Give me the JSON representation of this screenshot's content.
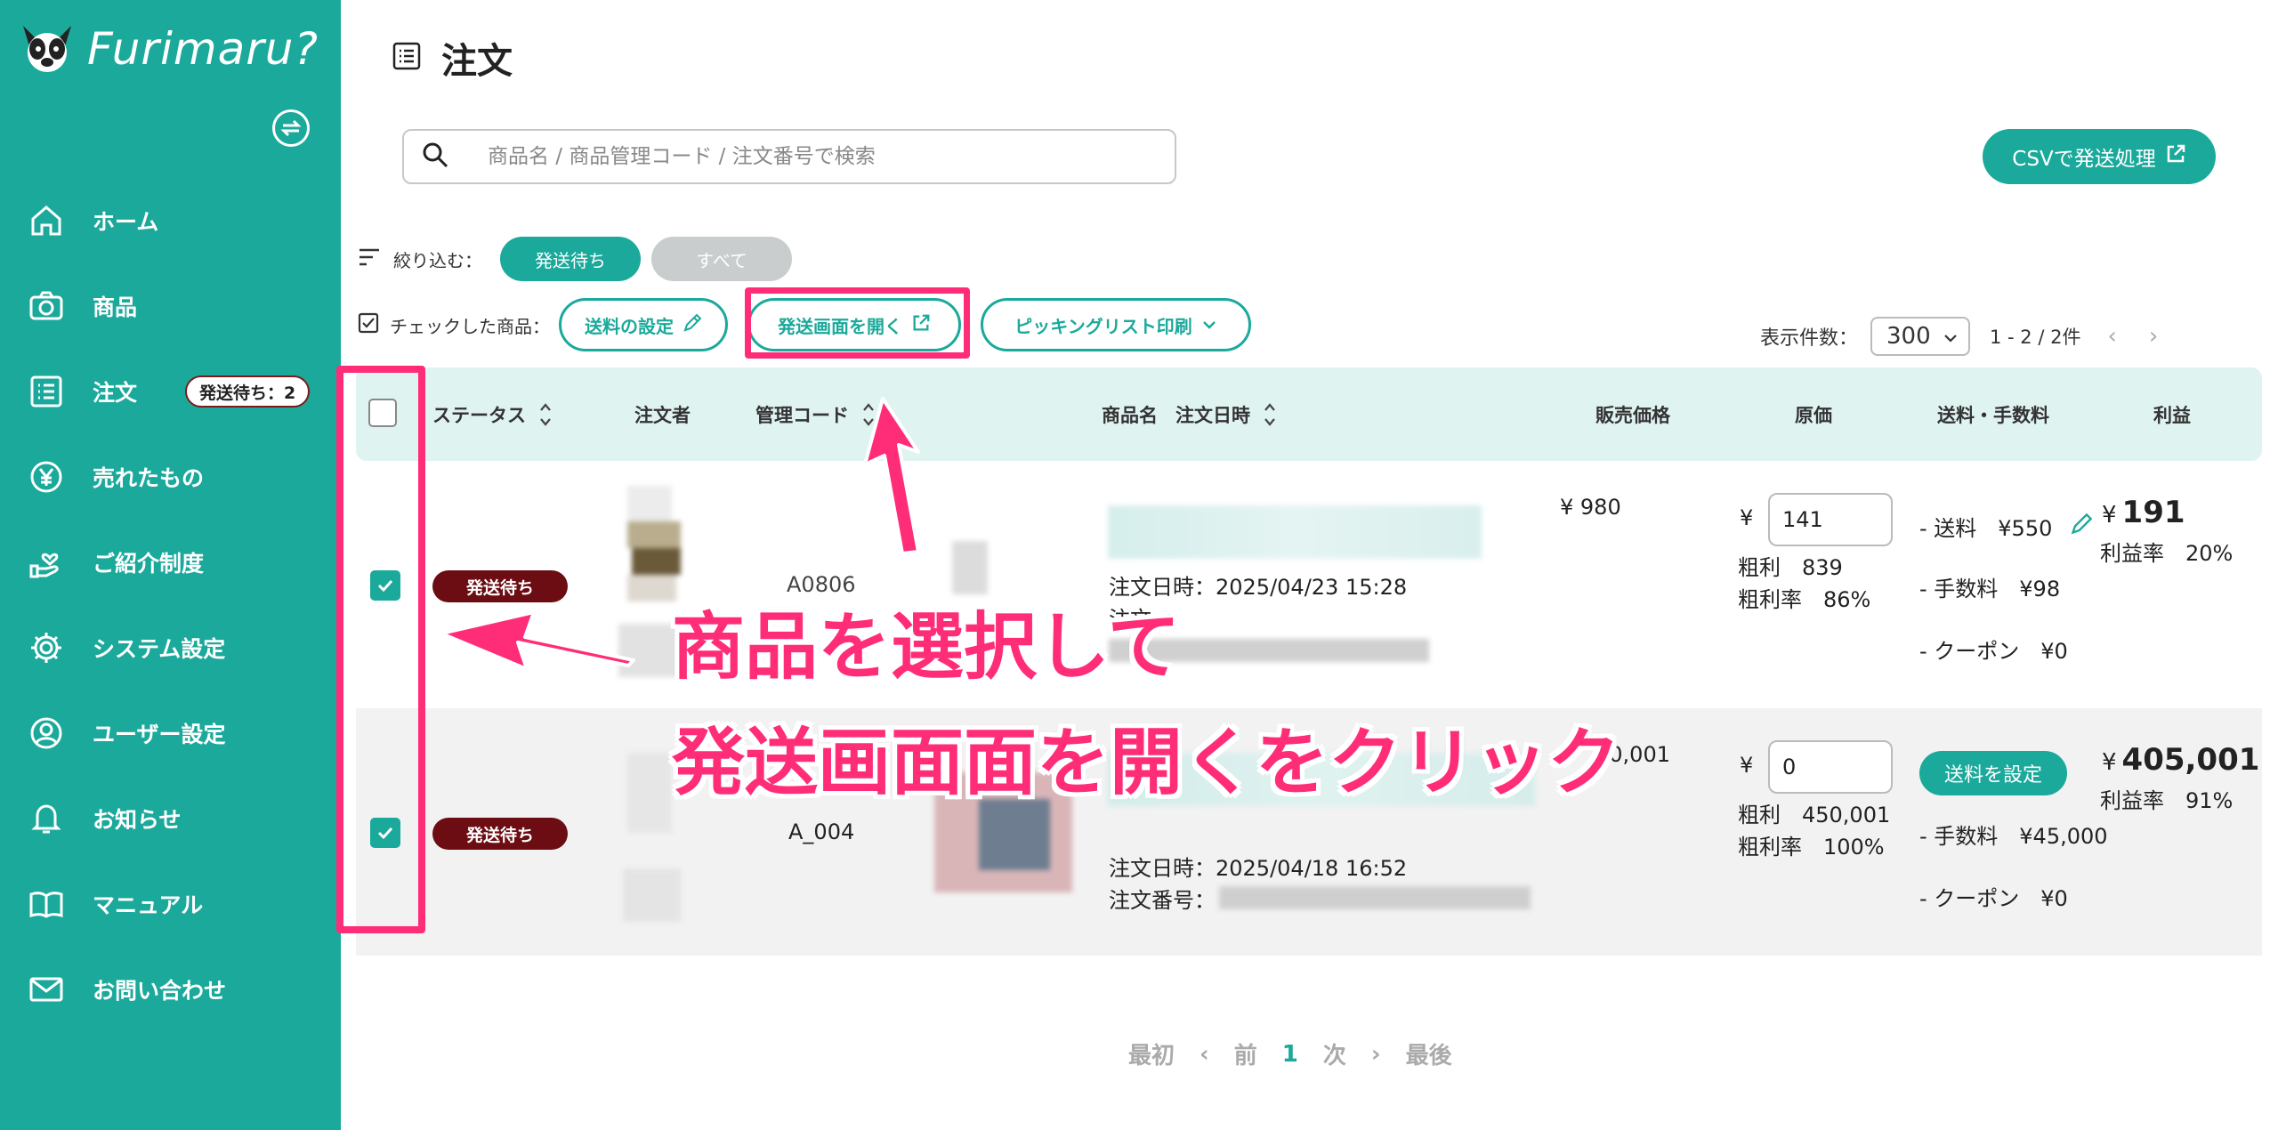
{
  "app": {
    "name": "Furimaru?"
  },
  "sidebar": {
    "items": [
      {
        "label": "ホーム",
        "icon": "home-icon"
      },
      {
        "label": "商品",
        "icon": "camera-icon"
      },
      {
        "label": "注文",
        "icon": "list-icon",
        "badge": "発送待ち：2"
      },
      {
        "label": "売れたもの",
        "icon": "yen-icon"
      },
      {
        "label": "ご紹介制度",
        "icon": "hand-heart-icon"
      },
      {
        "label": "システム設定",
        "icon": "gear-icon"
      },
      {
        "label": "ユーザー設定",
        "icon": "user-icon"
      },
      {
        "label": "お知らせ",
        "icon": "bell-icon"
      },
      {
        "label": "マニュアル",
        "icon": "book-icon"
      },
      {
        "label": "お問い合わせ",
        "icon": "mail-icon"
      }
    ]
  },
  "header": {
    "title": "注文"
  },
  "search": {
    "placeholder": "商品名 / 商品管理コード / 注文番号で検索"
  },
  "csv_button": "CSVで発送処理",
  "filter": {
    "label": "絞り込む：",
    "chips": [
      "発送待ち",
      "すべて"
    ]
  },
  "bulk": {
    "label": "チェックした商品：",
    "shipping_settings": "送料の設定",
    "open_shipping": "発送画面を開く",
    "picking_print": "ピッキングリスト印刷"
  },
  "per_page": {
    "label": "表示件数：",
    "value": "300",
    "range": "1 - 2 / 2件"
  },
  "columns": {
    "status": "ステータス",
    "orderer": "注文者",
    "code": "管理コード",
    "name": "商品名",
    "order_date": "注文日時",
    "price": "販売価格",
    "cost": "原価",
    "fees": "送料・手数料",
    "profit": "利益"
  },
  "rows": [
    {
      "status": "発送待ち",
      "code": "A0806",
      "order_date": "注文日時：2025/04/23 15:28",
      "order_no_label": "注文",
      "price": "¥ 980",
      "cost_yen": "¥",
      "cost": "141",
      "gross": "粗利　839",
      "gross_rate": "粗利率　86%",
      "shipping": "- 送料　¥550",
      "fee": "- 手数料　¥98",
      "coupon": "- クーポン　¥0",
      "profit": "191",
      "profit_rate": "利益率　20%"
    },
    {
      "status": "発送待ち",
      "code": "A_004",
      "order_date": "注文日時：2025/04/18 16:52",
      "order_no_label": "注文番号：",
      "price": "50,001",
      "cost_yen": "¥",
      "cost": "0",
      "gross": "粗利　450,001",
      "gross_rate": "粗利率　100%",
      "ship_button": "送料を設定",
      "fee": "- 手数料　¥45,000",
      "coupon": "- クーポン　¥0",
      "profit": "405,001",
      "profit_rate": "利益率　91%"
    }
  ],
  "pagination": {
    "first": "最初",
    "prev": "前",
    "current": "1",
    "next": "次",
    "last": "最後"
  },
  "annotation": {
    "line1": "商品を選択して",
    "line2": "発送画面面を開くをクリック"
  },
  "colors": {
    "brand": "#1aa99b",
    "status": "#6b0d12",
    "annotation": "#ff2d78"
  }
}
